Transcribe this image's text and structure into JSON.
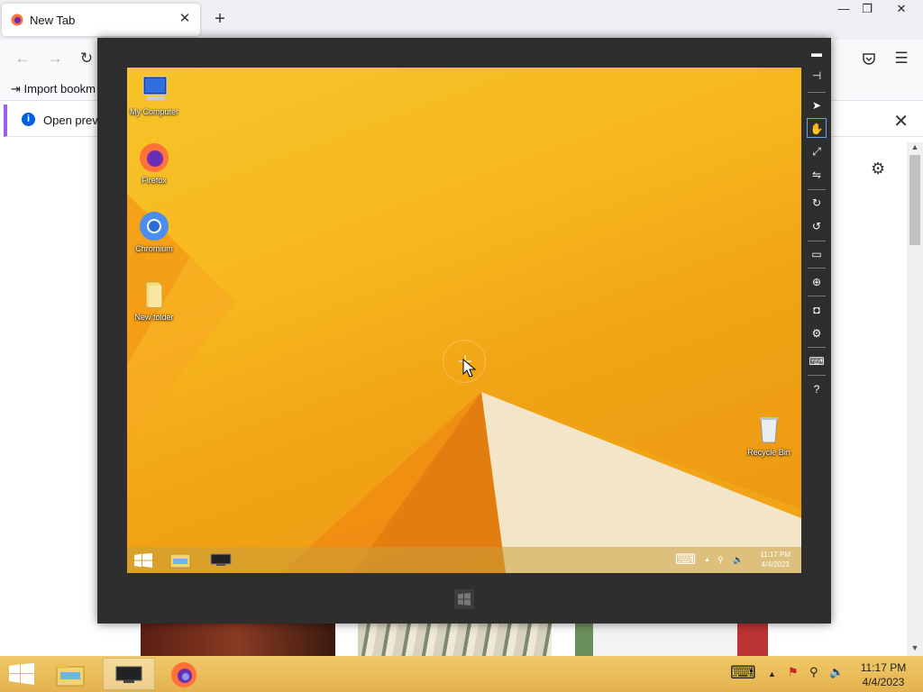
{
  "browser": {
    "tab": {
      "title": "New Tab",
      "close_glyph": "✕",
      "icon": "firefox-icon"
    },
    "new_tab_glyph": "+",
    "window_controls": {
      "minimize": "—",
      "restore": "❐",
      "close": "✕"
    },
    "nav": {
      "back": "←",
      "forward": "→",
      "reload": "↻",
      "pocket": "pocket-icon",
      "menu": "☰"
    },
    "bookmarks_item": "Import bookm",
    "notification": {
      "text": "Open previo",
      "close_glyph": "✕"
    },
    "settings_glyph": "⚙",
    "scroll_up": "▲",
    "scroll_down": "▼"
  },
  "viewer": {
    "toolbar": [
      {
        "name": "minimize-viewer-icon",
        "glyph": "▬"
      },
      {
        "name": "pin-icon",
        "glyph": "⊣"
      },
      {
        "name": "pointer-tool-icon",
        "glyph": "➤"
      },
      {
        "name": "hand-tool-icon",
        "glyph": "✋",
        "selected": true
      },
      {
        "name": "fit-screen-icon",
        "glyph": "⤢"
      },
      {
        "name": "switch-mode-icon",
        "glyph": "⇋"
      },
      {
        "name": "rotate-right-icon",
        "glyph": "↻"
      },
      {
        "name": "rotate-left-icon",
        "glyph": "↺"
      },
      {
        "name": "monitor-icon",
        "glyph": "▭"
      },
      {
        "name": "globe-icon",
        "glyph": "⊕"
      },
      {
        "name": "camera-icon",
        "glyph": "◘"
      },
      {
        "name": "settings-icon",
        "glyph": "⚙"
      },
      {
        "name": "keyboard-toggle-icon",
        "glyph": "⌨"
      },
      {
        "name": "help-icon",
        "glyph": "?"
      }
    ],
    "desktop_icons": [
      {
        "label": "My Computer",
        "icon": "computer-icon"
      },
      {
        "label": "Firefox",
        "icon": "firefox-icon"
      },
      {
        "label": "Chromium",
        "icon": "chromium-icon"
      },
      {
        "label": "New folder",
        "icon": "folder-icon"
      },
      {
        "label": "Recycle Bin",
        "icon": "recycle-bin-icon"
      }
    ],
    "remote_taskbar": {
      "clock_time": "11:17 PM",
      "clock_date": "4/4/2023",
      "tray": {
        "keyboard": "⌨",
        "chevron": "▲",
        "network": "⚲",
        "volume": "🔈"
      }
    }
  },
  "host_taskbar": {
    "clock_time": "11:17 PM",
    "clock_date": "4/4/2023",
    "tray": {
      "keyboard": "⌨",
      "chevron": "▲",
      "flag": "⚑",
      "network": "⚲",
      "volume": "🔈"
    }
  },
  "colors": {
    "desktop_orange": "#f6b81e",
    "taskbar_gold": "#e9bb55",
    "viewer_frame": "#2e2e2e"
  }
}
